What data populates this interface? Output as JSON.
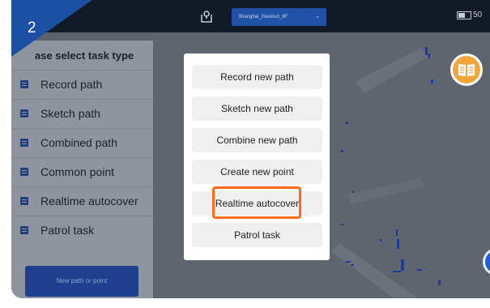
{
  "step_badge": "2",
  "topbar": {
    "map_select": "Shanghai_Gaoxiun_6F",
    "battery_text": "50"
  },
  "sidebar": {
    "title": "ase select task type",
    "items": [
      {
        "label": "Record path"
      },
      {
        "label": "Sketch path"
      },
      {
        "label": "Combined path"
      },
      {
        "label": "Common point"
      },
      {
        "label": "Realtime autocover"
      },
      {
        "label": "Patrol task"
      }
    ],
    "new_button": "New path or point"
  },
  "popup_menu": {
    "items": [
      {
        "label": "Record new path"
      },
      {
        "label": "Sketch new path"
      },
      {
        "label": "Combine new path"
      },
      {
        "label": "Create new point"
      },
      {
        "label": "Realtime autocover"
      },
      {
        "label": "Patrol task"
      }
    ],
    "highlighted_item": "Realtime autocover"
  },
  "icons": {
    "map_location": "map-location-icon",
    "battery": "battery-icon",
    "task_item": "list-doc-icon",
    "book": "book-icon"
  },
  "colors": {
    "accent_blue": "#1f3f8f",
    "highlight_orange": "#ff6a14",
    "book_orange": "#f0a63a"
  }
}
